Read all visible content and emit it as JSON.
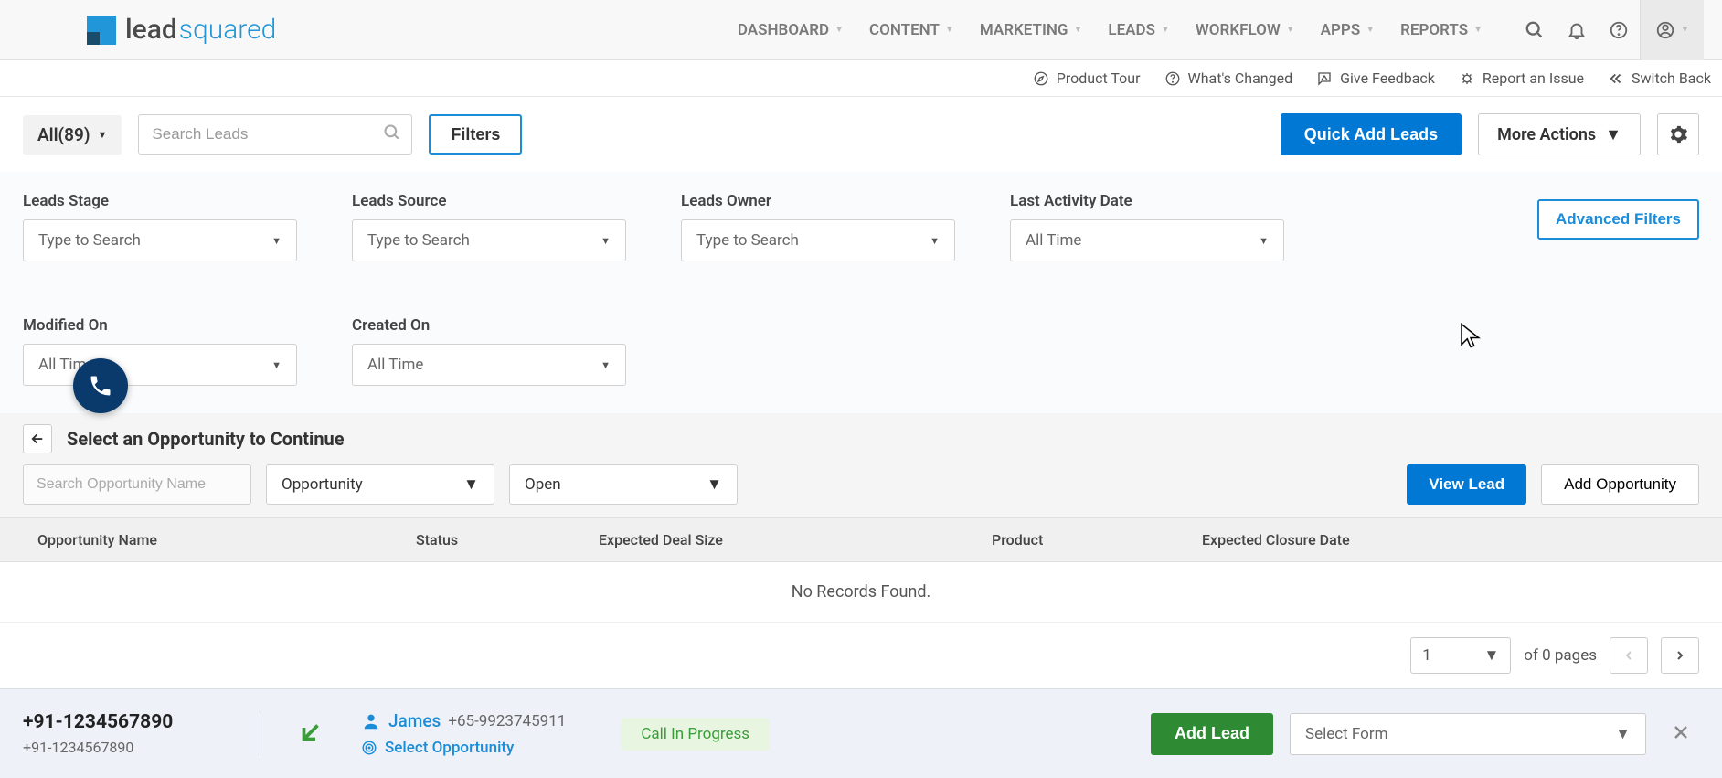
{
  "logo": {
    "part1": "lead",
    "part2": "squared"
  },
  "nav": {
    "items": [
      "DASHBOARD",
      "CONTENT",
      "MARKETING",
      "LEADS",
      "WORKFLOW",
      "APPS",
      "REPORTS"
    ]
  },
  "secondary": {
    "product_tour": "Product Tour",
    "whats_changed": "What's Changed",
    "give_feedback": "Give Feedback",
    "report_issue": "Report an Issue",
    "switch_back": "Switch Back"
  },
  "toolbar": {
    "all_label": "All(89)",
    "search_placeholder": "Search Leads",
    "filters_label": "Filters",
    "quick_add": "Quick Add Leads",
    "more_actions": "More Actions"
  },
  "filters": {
    "stage": {
      "label": "Leads Stage",
      "value": "Type to Search"
    },
    "source": {
      "label": "Leads Source",
      "value": "Type to Search"
    },
    "owner": {
      "label": "Leads Owner",
      "value": "Type to Search"
    },
    "last_activity": {
      "label": "Last Activity Date",
      "value": "All Time"
    },
    "modified": {
      "label": "Modified On",
      "value": "All Time"
    },
    "created": {
      "label": "Created On",
      "value": "All Time"
    },
    "advanced": "Advanced Filters"
  },
  "opportunity": {
    "title": "Select an Opportunity to Continue",
    "search_placeholder": "Search Opportunity Name",
    "type_select": "Opportunity",
    "status_select": "Open",
    "view_lead": "View Lead",
    "add_opp": "Add Opportunity",
    "columns": {
      "name": "Opportunity Name",
      "status": "Status",
      "deal_size": "Expected Deal Size",
      "product": "Product",
      "closure": "Expected Closure Date"
    },
    "no_records": "No Records Found.",
    "pager": {
      "page": "1",
      "of_text": "of 0 pages"
    }
  },
  "call": {
    "number_primary": "+91-1234567890",
    "number_secondary": "+91-1234567890",
    "contact_name": "James",
    "contact_phone": "+65-9923745911",
    "select_opp": "Select Opportunity",
    "status": "Call In Progress",
    "add_lead": "Add Lead",
    "select_form": "Select Form"
  }
}
